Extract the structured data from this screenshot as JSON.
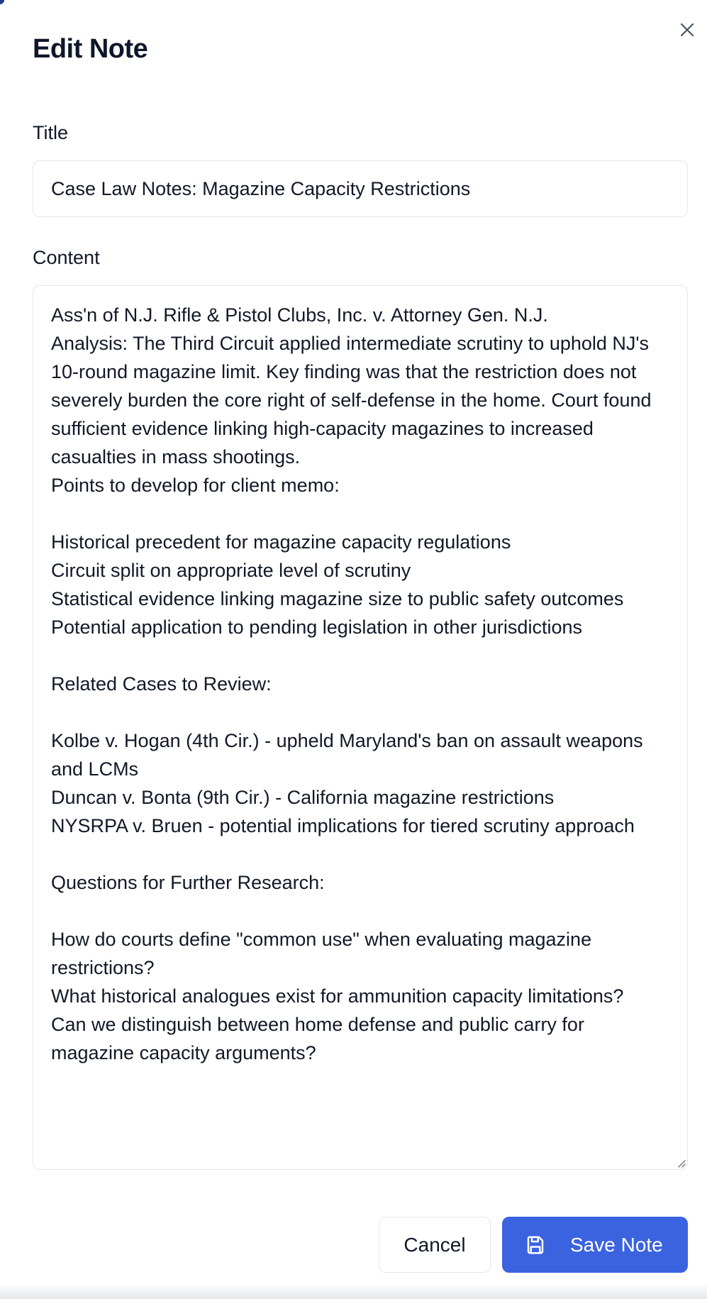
{
  "dialog": {
    "title": "Edit Note",
    "close_icon": "close-icon"
  },
  "form": {
    "title_label": "Title",
    "title_value": "Case Law Notes: Magazine Capacity Restrictions",
    "content_label": "Content",
    "content_value": "Ass'n of N.J. Rifle & Pistol Clubs, Inc. v. Attorney Gen. N.J.\nAnalysis: The Third Circuit applied intermediate scrutiny to uphold NJ's 10-round magazine limit. Key finding was that the restriction does not severely burden the core right of self-defense in the home. Court found sufficient evidence linking high-capacity magazines to increased casualties in mass shootings.\nPoints to develop for client memo:\n\nHistorical precedent for magazine capacity regulations\nCircuit split on appropriate level of scrutiny\nStatistical evidence linking magazine size to public safety outcomes\nPotential application to pending legislation in other jurisdictions\n\nRelated Cases to Review:\n\nKolbe v. Hogan (4th Cir.) - upheld Maryland's ban on assault weapons and LCMs\nDuncan v. Bonta (9th Cir.) - California magazine restrictions\nNYSRPA v. Bruen - potential implications for tiered scrutiny approach\n\nQuestions for Further Research:\n\nHow do courts define \"common use\" when evaluating magazine restrictions?\nWhat historical analogues exist for ammunition capacity limitations?\nCan we distinguish between home defense and public carry for magazine capacity arguments?"
  },
  "actions": {
    "cancel_label": "Cancel",
    "save_label": "Save Note",
    "save_icon": "save-icon"
  },
  "colors": {
    "primary": "#3b63e0",
    "border": "#e5e7eb",
    "text": "#111827"
  }
}
